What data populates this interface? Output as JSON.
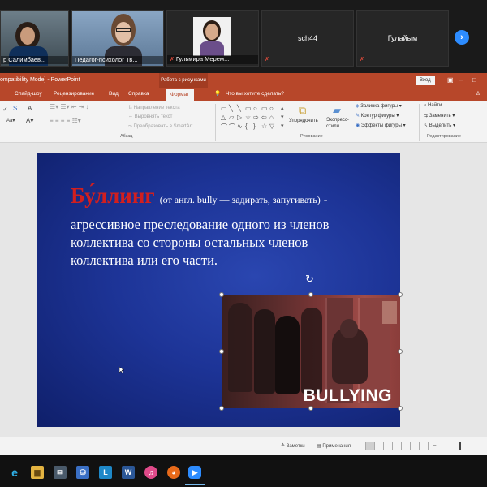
{
  "participants": [
    {
      "name": "р Салимбаев..."
    },
    {
      "name": "Педагог-психолог Тв..."
    },
    {
      "name": "Гульмира Мерем..."
    },
    {
      "name": "sch44"
    },
    {
      "name": "Гулайым"
    }
  ],
  "powerpoint": {
    "window_title": "ompatibility Mode]  -  PowerPoint",
    "contextual_tab_group": "Работа с рисунками",
    "login_label": "Вход",
    "tabs": [
      "Слайд-шоу",
      "Рецензирование",
      "Вид",
      "Справка",
      "Формат"
    ],
    "tell_me": "Что вы хотите сделать?",
    "ribbon": {
      "text_direction": "Направление текста",
      "align_text": "Выровнять текст",
      "convert_smartart": "Преобразовать в SmartArt",
      "paragraph_group": "Абзац",
      "arrange": "Упорядочить",
      "quick_styles": "Экспресс-стили",
      "shape_fill": "Заливка фигуры",
      "shape_outline": "Контур фигуры",
      "shape_effects": "Эффекты фигуры",
      "drawing_group": "Рисование",
      "find": "Найти",
      "replace": "Заменить",
      "select": "Выделить",
      "editing_group": "Редактирование"
    },
    "status": {
      "notes": "Заметки",
      "comments": "Примечания"
    }
  },
  "slide": {
    "term": "Бу́ллинг",
    "etymology": "(от англ. bully — задирать, запугивать)",
    "dash": "-",
    "definition_lines": [
      "агрессивное преследование одного из членов",
      "коллектива со стороны остальных членов",
      "коллектива или его части."
    ],
    "picture_caption": "BULLYING",
    "colors": {
      "term": "#d11f1f",
      "background": "#1d3497"
    }
  },
  "taskbar": {
    "apps": [
      "edge-icon",
      "file-explorer-icon",
      "store-icon",
      "l-app-icon",
      "word-icon",
      "music-icon",
      "firefox-icon",
      "zoom-icon"
    ]
  }
}
